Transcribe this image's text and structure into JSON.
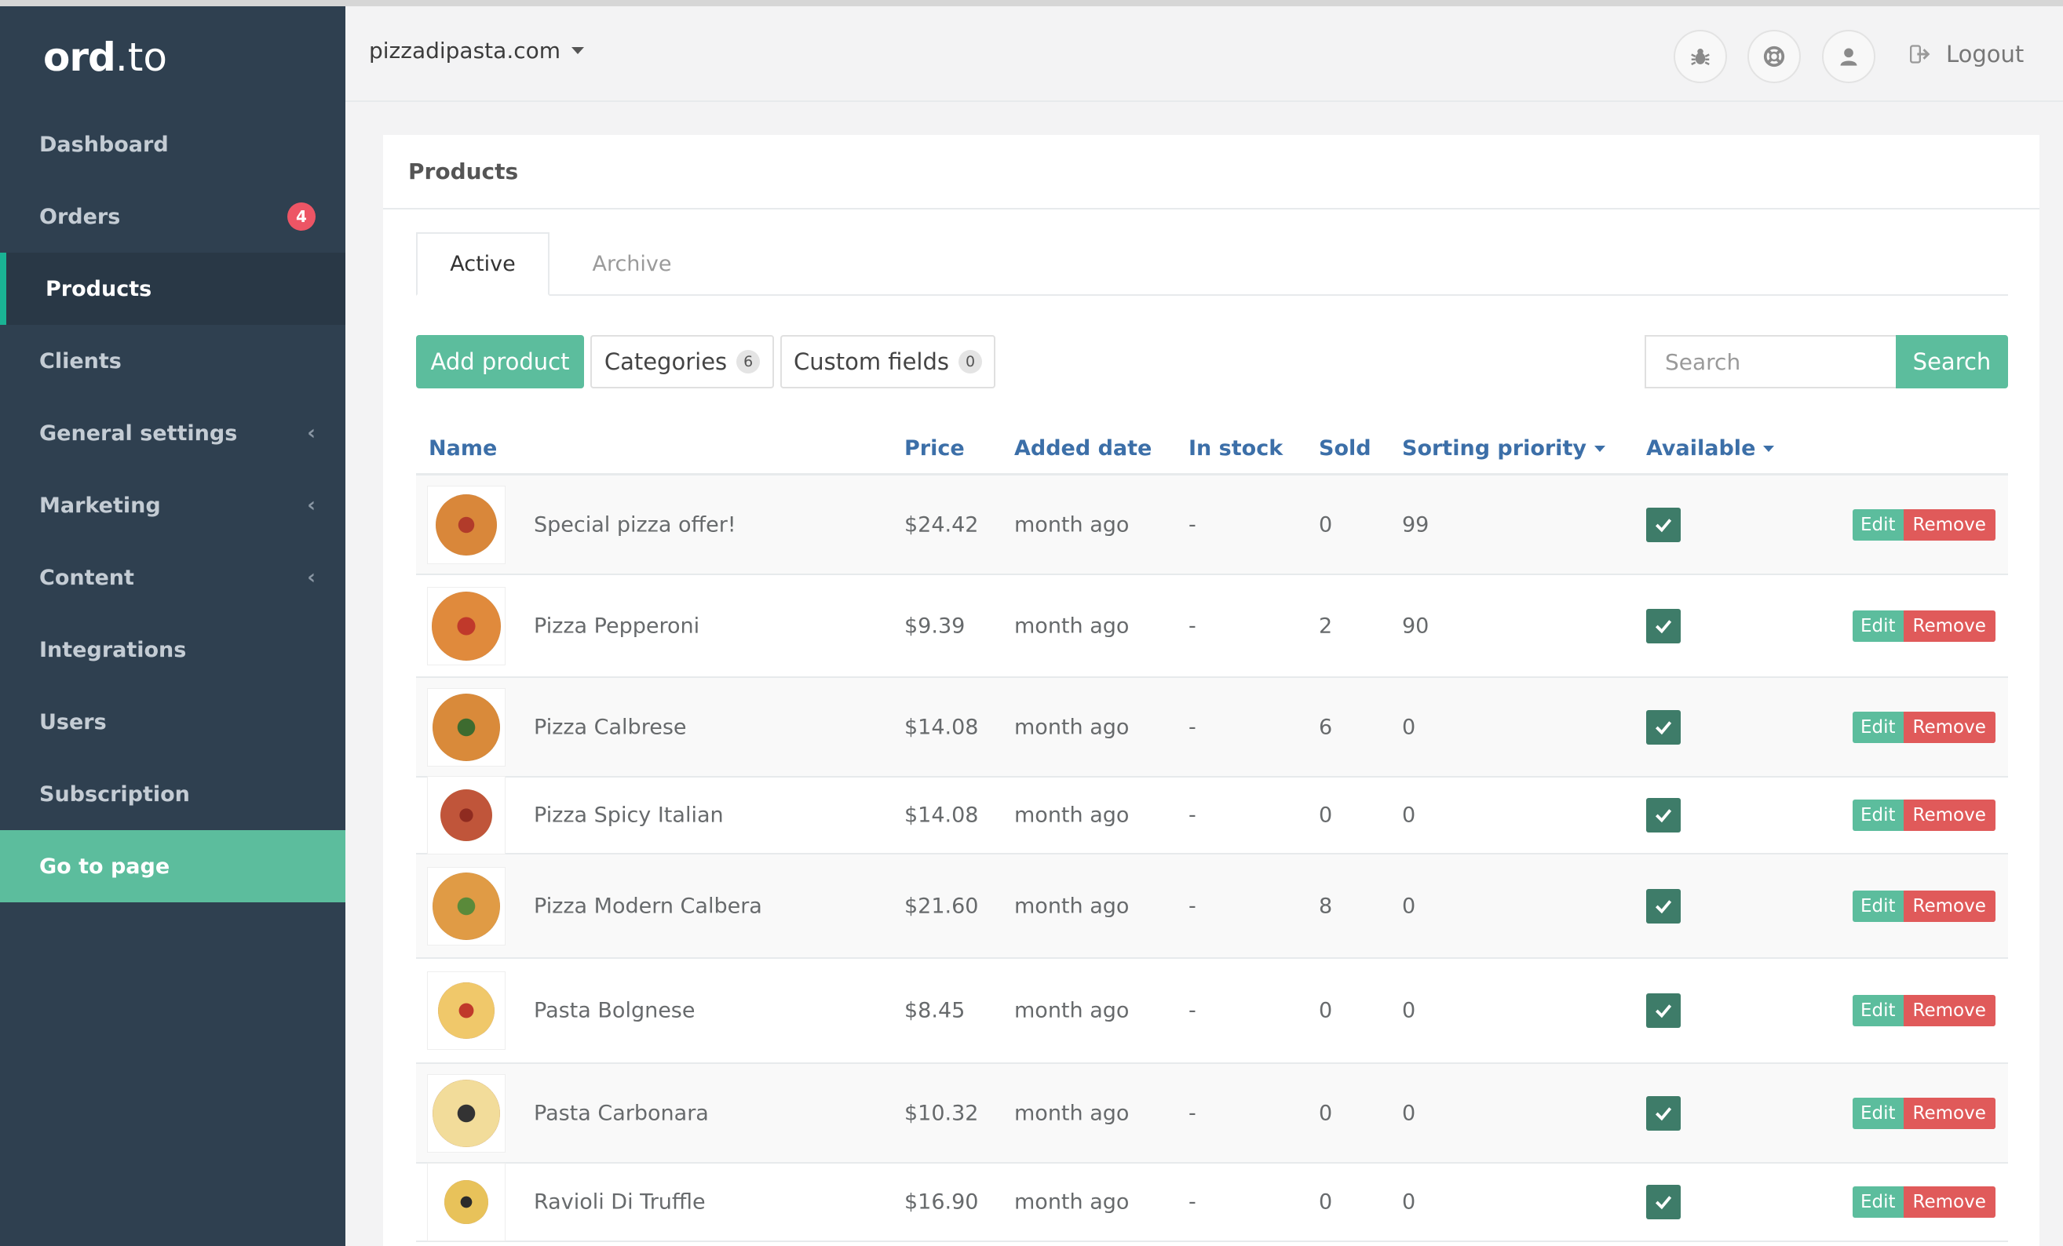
{
  "brand": {
    "bold": "ord",
    "dot": ".",
    "tld": "to"
  },
  "sidebar": {
    "items": [
      {
        "label": "Dashboard"
      },
      {
        "label": "Orders",
        "badge": "4"
      },
      {
        "label": "Products"
      },
      {
        "label": "Clients"
      },
      {
        "label": "General settings"
      },
      {
        "label": "Marketing"
      },
      {
        "label": "Content"
      },
      {
        "label": "Integrations"
      },
      {
        "label": "Users"
      },
      {
        "label": "Subscription"
      },
      {
        "label": "Go to page"
      }
    ]
  },
  "topbar": {
    "domain": "pizzadipasta.com",
    "logout": "Logout"
  },
  "panel": {
    "title": "Products"
  },
  "tabs": {
    "active": "Active",
    "archive": "Archive"
  },
  "toolbar": {
    "add_product": "Add product",
    "categories": "Categories",
    "categories_count": "6",
    "custom_fields": "Custom fields",
    "custom_fields_count": "0",
    "search_placeholder": "Search",
    "search_button": "Search"
  },
  "table": {
    "headers": {
      "name": "Name",
      "price": "Price",
      "added": "Added date",
      "stock": "In stock",
      "sold": "Sold",
      "priority": "Sorting priority",
      "available": "Available"
    },
    "edit_label": "Edit",
    "remove_label": "Remove",
    "rows": [
      {
        "name": "Special pizza offer!",
        "price": "$24.42",
        "added": "month ago",
        "stock": "-",
        "sold": "0",
        "priority": "99",
        "available": true
      },
      {
        "name": "Pizza Pepperoni",
        "price": "$9.39",
        "added": "month ago",
        "stock": "-",
        "sold": "2",
        "priority": "90",
        "available": true
      },
      {
        "name": "Pizza Calbrese",
        "price": "$14.08",
        "added": "month ago",
        "stock": "-",
        "sold": "6",
        "priority": "0",
        "available": true
      },
      {
        "name": "Pizza Spicy Italian",
        "price": "$14.08",
        "added": "month ago",
        "stock": "-",
        "sold": "0",
        "priority": "0",
        "available": true
      },
      {
        "name": "Pizza Modern Calbera",
        "price": "$21.60",
        "added": "month ago",
        "stock": "-",
        "sold": "8",
        "priority": "0",
        "available": true
      },
      {
        "name": "Pasta Bolgnese",
        "price": "$8.45",
        "added": "month ago",
        "stock": "-",
        "sold": "0",
        "priority": "0",
        "available": true
      },
      {
        "name": "Pasta Carbonara",
        "price": "$10.32",
        "added": "month ago",
        "stock": "-",
        "sold": "0",
        "priority": "0",
        "available": true
      },
      {
        "name": "Ravioli Di Truffle",
        "price": "$16.90",
        "added": "month ago",
        "stock": "-",
        "sold": "0",
        "priority": "0",
        "available": true
      }
    ]
  },
  "colors": {
    "sidebar_bg": "#2f4050",
    "accent_green": "#5cbd9d",
    "remove_red": "#e05a5a",
    "badge_red": "#ed5565",
    "link_blue": "#3c6fa8",
    "check_green": "#3e7c69"
  }
}
